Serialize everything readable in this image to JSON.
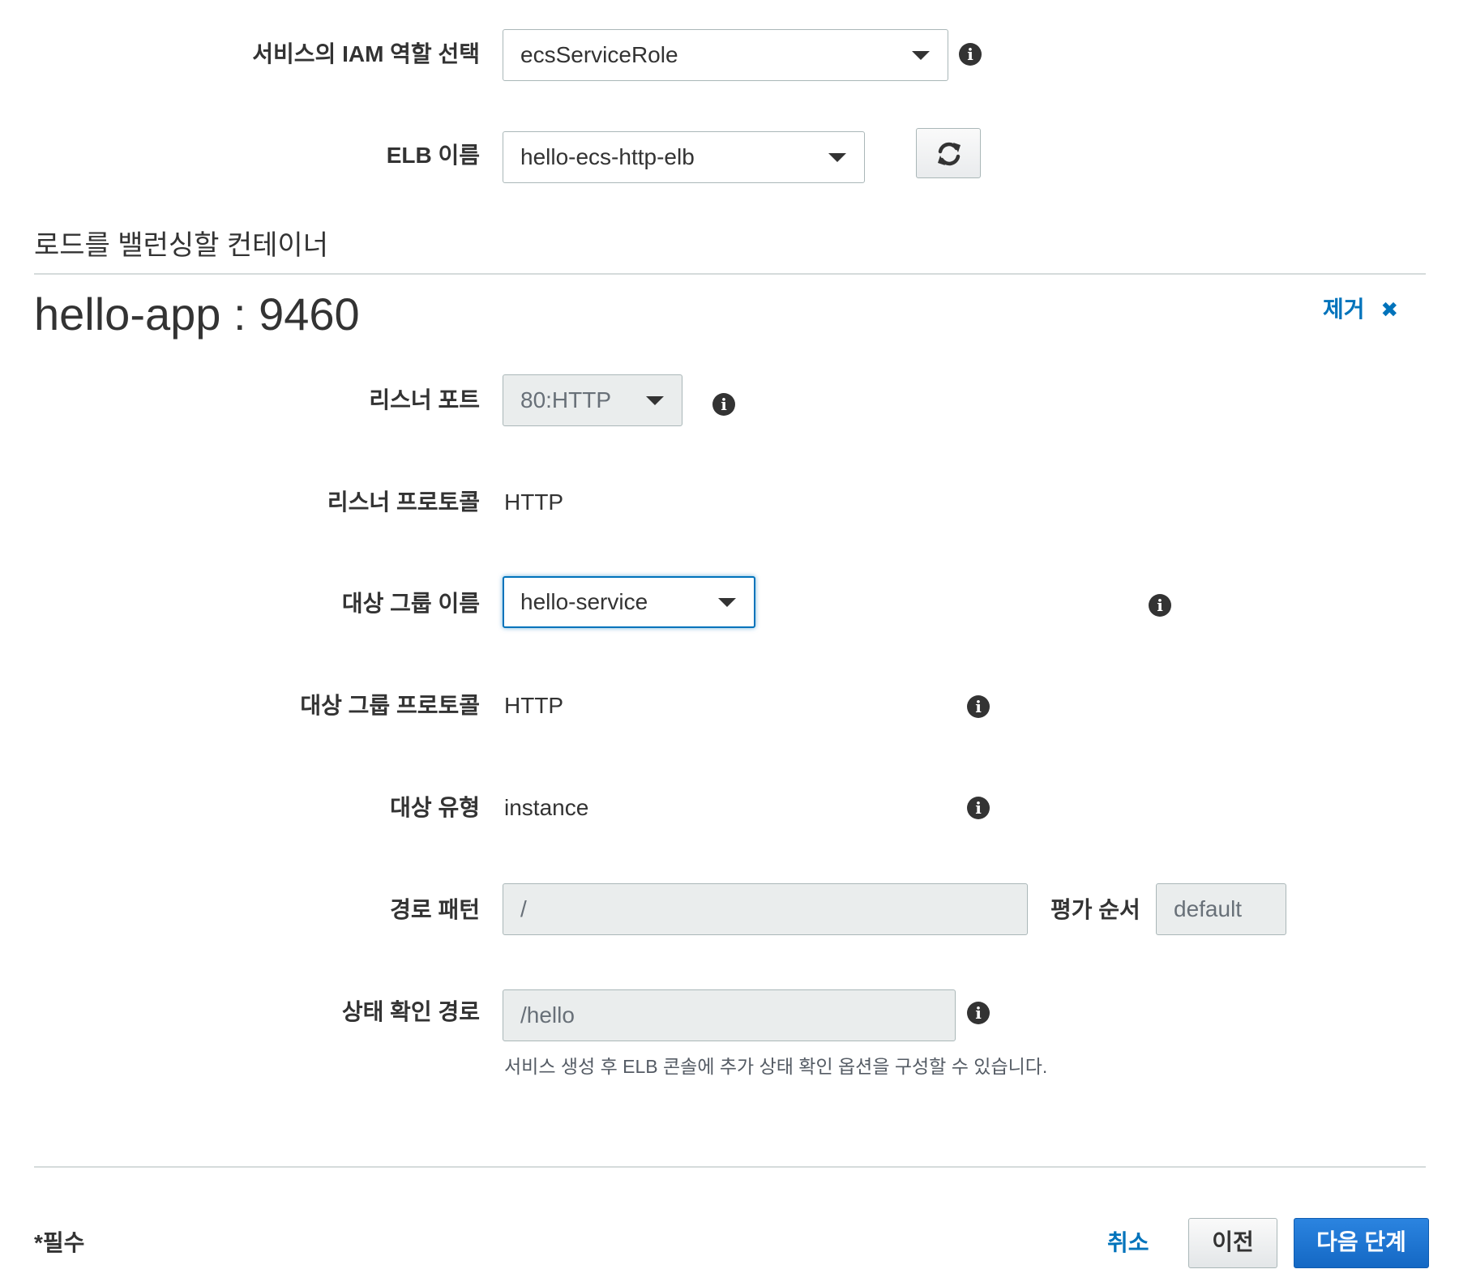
{
  "iam_role": {
    "label": "서비스의 IAM 역할 선택",
    "value": "ecsServiceRole"
  },
  "elb_name": {
    "label": "ELB 이름",
    "value": "hello-ecs-http-elb"
  },
  "section": {
    "title": "로드를 밸런싱할 컨테이너"
  },
  "container": {
    "name": "hello-app : 9460",
    "remove_label": "제거",
    "remove_icon": "✖"
  },
  "listener_port": {
    "label": "리스너 포트",
    "value": "80:HTTP"
  },
  "listener_protocol": {
    "label": "리스너 프로토콜",
    "value": "HTTP"
  },
  "target_group_name": {
    "label": "대상 그룹 이름",
    "value": "hello-service"
  },
  "target_group_protocol": {
    "label": "대상 그룹 프로토콜",
    "value": "HTTP"
  },
  "target_type": {
    "label": "대상 유형",
    "value": "instance"
  },
  "path_pattern": {
    "label": "경로 패턴",
    "value": "/"
  },
  "evaluation_order": {
    "label": "평가 순서",
    "value": "default"
  },
  "health_check_path": {
    "label": "상태 확인 경로",
    "value": "/hello",
    "help_text": "서비스 생성 후 ELB 콘솔에 추가 상태 확인 옵션을 구성할 수 있습니다."
  },
  "footer": {
    "required_note": "*필수",
    "cancel_label": "취소",
    "previous_label": "이전",
    "next_label": "다음 단계"
  },
  "colors": {
    "link": "#0073bb",
    "primary_button": "#1a74d6",
    "info_icon": "#333333"
  },
  "icons": {
    "info": "i",
    "refresh": "refresh-icon",
    "dropdown": "caret-down-icon"
  }
}
